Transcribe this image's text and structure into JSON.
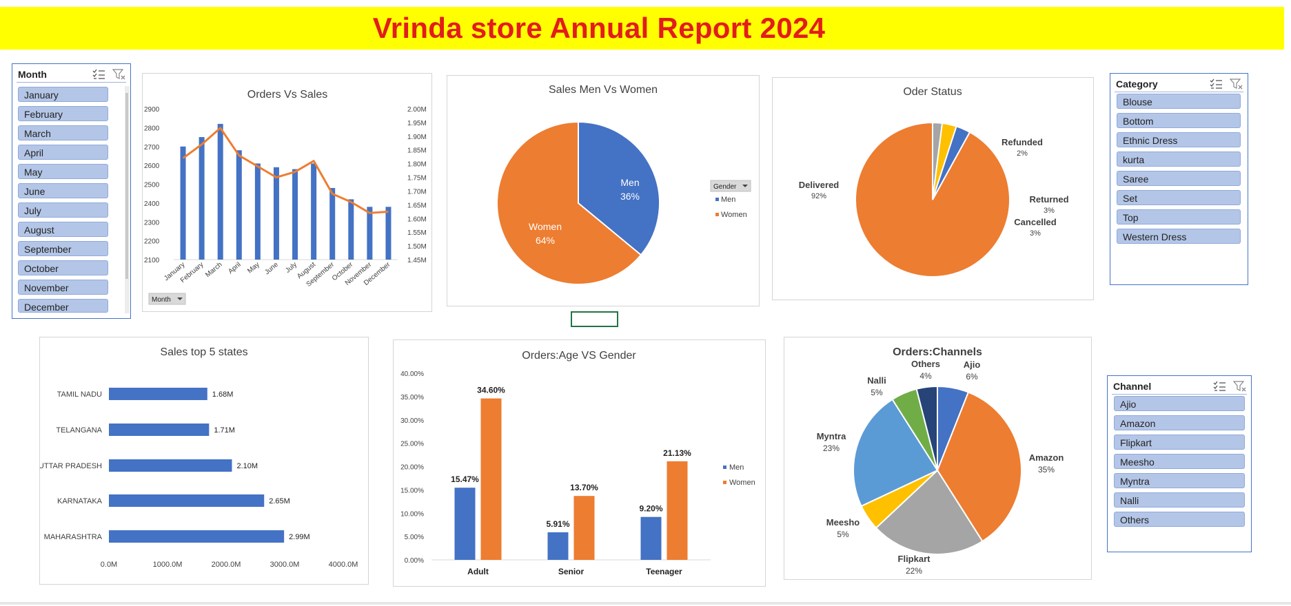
{
  "header": {
    "title": "Vrinda store Annual Report 2024"
  },
  "colors": {
    "blue": "#4472c4",
    "orange": "#ed7d31",
    "gray": "#a5a5a5",
    "yellow": "#ffc000",
    "lightblue": "#5b9bd5",
    "green": "#70ad47",
    "navy": "#264478",
    "title_red": "#e31c1c",
    "title_bg": "#ffff00"
  },
  "slicers": {
    "month": {
      "title": "Month",
      "items": [
        "January",
        "February",
        "March",
        "April",
        "May",
        "June",
        "July",
        "August",
        "September",
        "October",
        "November",
        "December"
      ]
    },
    "category": {
      "title": "Category",
      "items": [
        "Blouse",
        "Bottom",
        "Ethnic Dress",
        "kurta",
        "Saree",
        "Set",
        "Top",
        "Western Dress"
      ]
    },
    "channel": {
      "title": "Channel",
      "items": [
        "Ajio",
        "Amazon",
        "Flipkart",
        "Meesho",
        "Myntra",
        "Nalli",
        "Others"
      ]
    }
  },
  "chart_data": [
    {
      "id": "orders_vs_sales",
      "type": "bar",
      "title": "Orders Vs Sales",
      "categories": [
        "January",
        "February",
        "March",
        "April",
        "May",
        "June",
        "July",
        "August",
        "September",
        "October",
        "November",
        "December"
      ],
      "series": [
        {
          "kind": "bar",
          "axis": "left",
          "values": [
            2700,
            2750,
            2820,
            2680,
            2610,
            2590,
            2580,
            2610,
            2480,
            2420,
            2380,
            2380
          ]
        },
        {
          "kind": "line",
          "axis": "right",
          "values": [
            1.82,
            1.87,
            1.93,
            1.83,
            1.79,
            1.75,
            1.77,
            1.81,
            1.69,
            1.66,
            1.62,
            1.625
          ]
        }
      ],
      "left_ticks": [
        "2100",
        "2200",
        "2300",
        "2400",
        "2500",
        "2600",
        "2700",
        "2800",
        "2900"
      ],
      "right_ticks": [
        "1.45M",
        "1.50M",
        "1.55M",
        "1.60M",
        "1.65M",
        "1.70M",
        "1.75M",
        "1.80M",
        "1.85M",
        "1.90M",
        "1.95M",
        "2.00M"
      ],
      "ylim_left": [
        2100,
        2900
      ],
      "ylim_right": [
        1.45,
        2.0
      ],
      "field_button": "Month",
      "grid": false
    },
    {
      "id": "sales_men_women",
      "type": "pie",
      "title": "Sales Men Vs Women",
      "labels": [
        "Men",
        "Women"
      ],
      "values": [
        36,
        64
      ],
      "percent_labels": [
        "36%",
        "64%"
      ],
      "legend_button": "Gender",
      "legend": [
        "Men",
        "Women"
      ],
      "legend_position": "right"
    },
    {
      "id": "order_status",
      "type": "pie",
      "title": "Oder Status",
      "labels": [
        "Delivered",
        "Refunded",
        "Returned",
        "Cancelled"
      ],
      "values": [
        92,
        2,
        3,
        3
      ],
      "percent_labels": [
        "92%",
        "2%",
        "3%",
        "3%"
      ]
    },
    {
      "id": "sales_top_states",
      "type": "bar",
      "orientation": "horizontal",
      "title": "Sales top 5 states",
      "categories": [
        "TAMIL NADU",
        "TELANGANA",
        "UTTAR PRADESH",
        "KARNATAKA",
        "MAHARASHTRA"
      ],
      "values": [
        1.68,
        1.71,
        2.1,
        2.65,
        2.99
      ],
      "value_labels": [
        "1.68M",
        "1.71M",
        "2.10M",
        "2.65M",
        "2.99M"
      ],
      "x_ticks": [
        "0.0M",
        "1000.0M",
        "2000.0M",
        "3000.0M",
        "4000.0M"
      ],
      "xlim": [
        0,
        4.0
      ]
    },
    {
      "id": "orders_age_gender",
      "type": "bar",
      "title": "Orders:Age VS Gender",
      "categories": [
        "Adult",
        "Senior",
        "Teenager"
      ],
      "series": [
        {
          "name": "Men",
          "values": [
            15.47,
            5.91,
            9.2
          ],
          "labels": [
            "15.47%",
            "5.91%",
            "9.20%"
          ]
        },
        {
          "name": "Women",
          "values": [
            34.6,
            13.7,
            21.13
          ],
          "labels": [
            "34.60%",
            "13.70%",
            "21.13%"
          ]
        }
      ],
      "y_ticks": [
        "0.00%",
        "5.00%",
        "10.00%",
        "15.00%",
        "20.00%",
        "25.00%",
        "30.00%",
        "35.00%",
        "40.00%"
      ],
      "ylim": [
        0,
        40
      ],
      "legend_position": "right"
    },
    {
      "id": "orders_channels",
      "type": "pie",
      "title": "Orders:Channels",
      "labels": [
        "Ajio",
        "Amazon",
        "Flipkart",
        "Meesho",
        "Myntra",
        "Nalli",
        "Others"
      ],
      "values": [
        6,
        35,
        22,
        5,
        23,
        5,
        4
      ],
      "percent_labels": [
        "6%",
        "35%",
        "22%",
        "5%",
        "23%",
        "5%",
        "4%"
      ]
    }
  ]
}
